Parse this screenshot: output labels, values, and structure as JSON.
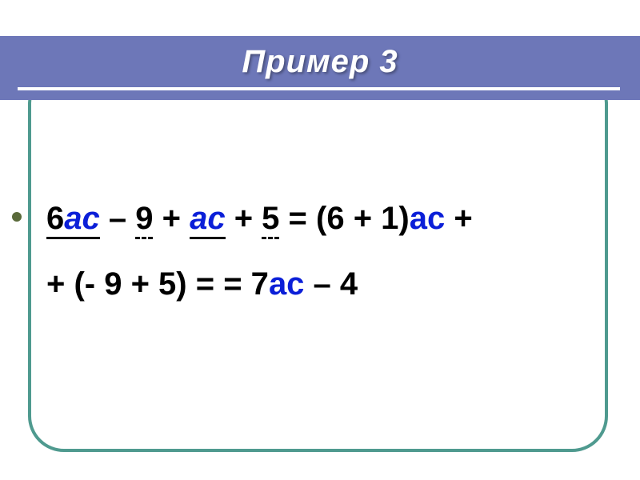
{
  "title": "Пример 3",
  "expr": {
    "line1": {
      "t1_coef": "6",
      "t1_var": "ac",
      "op1": " – ",
      "t2": "9",
      "op2": " + ",
      "t3_var": "ac",
      "op3": " + ",
      "t4": "5",
      "eq1": " = ",
      "grp1_open": "(6 + 1)",
      "grp1_var": "ac",
      "tail_plus": " +"
    },
    "line2": {
      "lead": "+ (- 9 + 5) = = 7",
      "var": "ac",
      "tail": " – 4"
    }
  }
}
